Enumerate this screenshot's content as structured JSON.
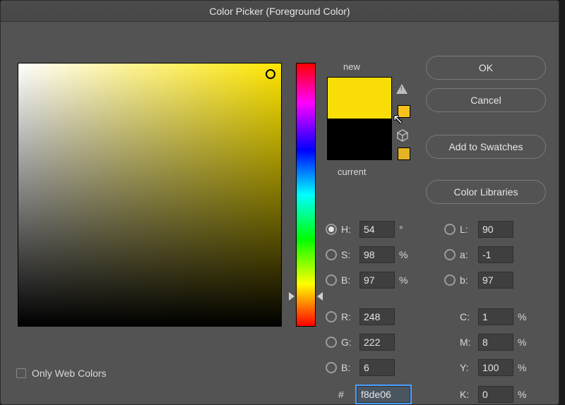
{
  "title": "Color Picker (Foreground Color)",
  "preview": {
    "new_label": "new",
    "current_label": "current",
    "new_color": "#f8de06",
    "current_color": "#000000"
  },
  "buttons": {
    "ok": "OK",
    "cancel": "Cancel",
    "add_swatches": "Add to Swatches",
    "color_libraries": "Color Libraries"
  },
  "only_web": {
    "label": "Only Web Colors",
    "checked": false
  },
  "hsb": {
    "h": {
      "label": "H:",
      "value": "54",
      "unit": "°",
      "selected": true
    },
    "s": {
      "label": "S:",
      "value": "98",
      "unit": "%",
      "selected": false
    },
    "b": {
      "label": "B:",
      "value": "97",
      "unit": "%",
      "selected": false
    }
  },
  "rgb": {
    "r": {
      "label": "R:",
      "value": "248",
      "selected": false
    },
    "g": {
      "label": "G:",
      "value": "222",
      "selected": false
    },
    "b": {
      "label": "B:",
      "value": "6",
      "selected": false
    }
  },
  "lab": {
    "l": {
      "label": "L:",
      "value": "90",
      "selected": false
    },
    "a": {
      "label": "a:",
      "value": "-1",
      "selected": false
    },
    "b": {
      "label": "b:",
      "value": "97",
      "selected": false
    }
  },
  "cmyk": {
    "c": {
      "label": "C:",
      "value": "1",
      "unit": "%"
    },
    "m": {
      "label": "M:",
      "value": "8",
      "unit": "%"
    },
    "y": {
      "label": "Y:",
      "value": "100",
      "unit": "%"
    },
    "k": {
      "label": "K:",
      "value": "0",
      "unit": "%"
    }
  },
  "hex": {
    "label": "#",
    "value": "f8de06"
  }
}
